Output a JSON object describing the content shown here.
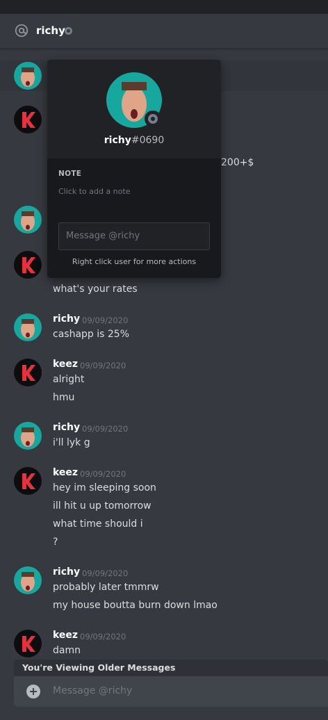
{
  "header": {
    "title": "richy"
  },
  "popout": {
    "username": "richy",
    "discriminator": "#0690",
    "note_label": "NOTE",
    "note_placeholder": "Click to add a note",
    "message_placeholder": "Message @richy",
    "hint": "Right click user for more actions"
  },
  "partial_text": "200+$",
  "messages": {
    "m3": {
      "line1": "what's your rates"
    },
    "m4": {
      "author": "richy",
      "timestamp": "09/09/2020",
      "line1": "cashapp is 25%"
    },
    "m5": {
      "author": "keez",
      "timestamp": "09/09/2020",
      "line1": "alright",
      "line2": "hmu"
    },
    "m6": {
      "author": "richy",
      "timestamp": "09/09/2020",
      "line1": "i'll lyk g"
    },
    "m7": {
      "author": "keez",
      "timestamp": "09/09/2020",
      "line1": "hey im sleeping soon",
      "line2": "ill hit u up tomorrow",
      "line3": "what time should i",
      "line4": "?"
    },
    "m8": {
      "author": "richy",
      "timestamp": "09/09/2020",
      "line1": "probably later tmmrw",
      "line2": "my house boutta burn down lmao"
    },
    "m9": {
      "author": "keez",
      "timestamp": "09/09/2020",
      "line1": "damn"
    }
  },
  "banner": "You're Viewing Older Messages",
  "composer": {
    "placeholder": "Message @richy"
  },
  "colors": {
    "background": "#36393f",
    "popout": "#18191c",
    "richy_avatar": "#16a89f",
    "keez_logo": "#e8313a",
    "offline": "#747f8d"
  },
  "icons": {
    "at": "at-icon",
    "status": "offline-status-icon",
    "plus": "add-attachment-icon"
  }
}
